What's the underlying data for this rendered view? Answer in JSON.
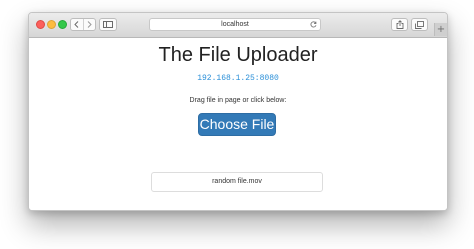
{
  "browser": {
    "address_bar": {
      "url_text": "localhost",
      "reload_icon": "reload-icon"
    },
    "icons": {
      "back": "chevron-left-icon",
      "forward": "chevron-right-icon",
      "sidebar": "sidebar-icon",
      "share": "share-icon",
      "tabs": "tabs-icon",
      "new_tab": "plus-icon"
    },
    "new_tab_glyph": "+",
    "traffic_lights": {
      "close": "#fc605c",
      "minimize": "#fdbc40",
      "zoom": "#34c84a"
    }
  },
  "page": {
    "title": "The File Uploader",
    "server_address": "192.168.1.25:8080",
    "instruction": "Drag file in page or click below:",
    "choose_button_label": "Choose File",
    "files": [
      {
        "name": "random file.mov"
      }
    ]
  },
  "colors": {
    "accent": "#337ab7",
    "link": "#2a8fd8"
  }
}
